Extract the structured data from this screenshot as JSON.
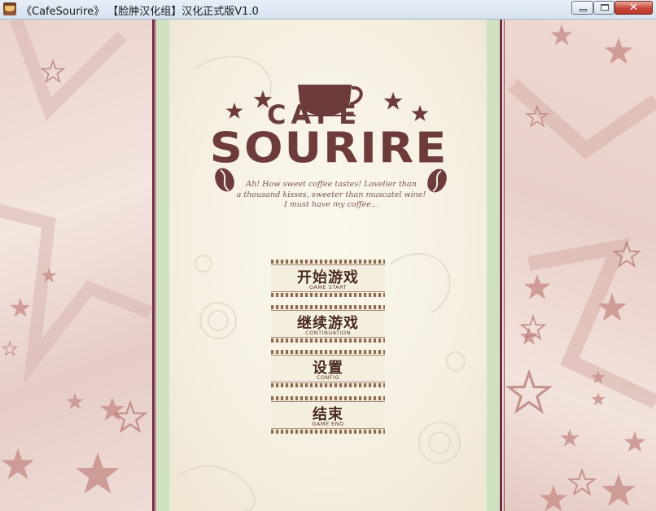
{
  "window": {
    "title": "《CafeSourire》 【脸肿汉化组】汉化正式版V1.0",
    "controls": {
      "minimize": "–",
      "maximize": "□",
      "close": "✕"
    }
  },
  "logo": {
    "cafe": "CAFE",
    "sourire": "SOURIRE",
    "tagline": [
      "Ah! How sweet coffee tastes! Lovelier than",
      "a thousand kisses, sweeter than muscatel wine!",
      "I must have my coffee..."
    ]
  },
  "menu": [
    {
      "label": "开始游戏",
      "sub": "GAME START"
    },
    {
      "label": "继续游戏",
      "sub": "CONTINUATION"
    },
    {
      "label": "设置",
      "sub": "CONFIG"
    },
    {
      "label": "结束",
      "sub": "GAME END"
    }
  ],
  "colors": {
    "maroon": "#6d2d3d",
    "green_stripe": "#cfe1bf",
    "logo_brown": "#6d3c3a",
    "star_pink": "#c79b96"
  }
}
